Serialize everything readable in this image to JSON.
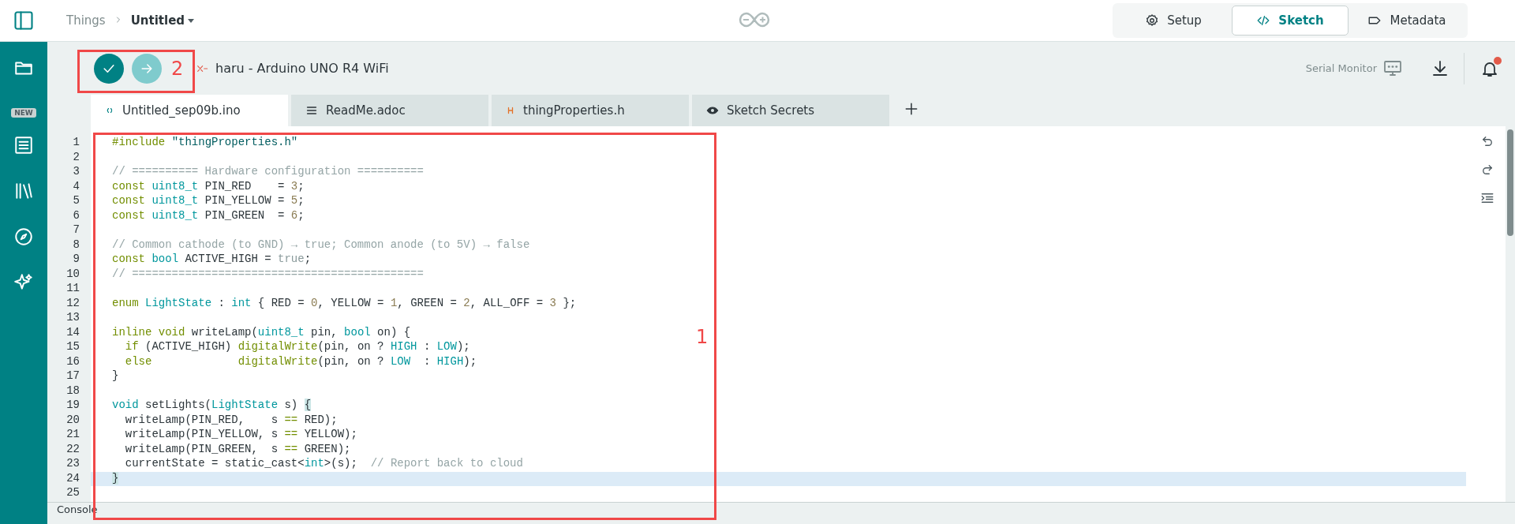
{
  "header": {
    "breadcrumb_root": "Things",
    "breadcrumb_current": "Untitled"
  },
  "view_tabs": [
    {
      "label": "Setup",
      "kind": "setup",
      "selected": false
    },
    {
      "label": "Sketch",
      "kind": "sketch",
      "selected": true
    },
    {
      "label": "Metadata",
      "kind": "metadata",
      "selected": false
    }
  ],
  "sidebar": {
    "new_badge": "NEW"
  },
  "toolbar": {
    "board": "haru - Arduino UNO R4 WiFi",
    "board_connected": false,
    "serial_monitor": "Serial Monitor",
    "notifications_unread": true
  },
  "file_tabs": [
    {
      "label": "Untitled_sep09b.ino",
      "kind": "code",
      "selected": true
    },
    {
      "label": "ReadMe.adoc",
      "kind": "doc",
      "selected": false
    },
    {
      "label": "thingProperties.h",
      "kind": "header",
      "selected": false
    },
    {
      "label": "Sketch Secrets",
      "kind": "secrets",
      "selected": false
    }
  ],
  "editor": {
    "lines": [
      {
        "number": "1",
        "current": false,
        "tokens": [
          {
            "text": "#include ",
            "kind": "kw"
          },
          {
            "text": "\"thingProperties.h\"",
            "kind": "str"
          }
        ]
      },
      {
        "number": "2",
        "current": false
      },
      {
        "number": "3",
        "current": false,
        "tokens": [
          {
            "text": "// ========== Hardware configuration ==========",
            "kind": "com"
          }
        ]
      },
      {
        "number": "4",
        "current": false,
        "tokens": [
          {
            "text": "const ",
            "kind": "kw"
          },
          {
            "text": "uint8_t",
            "kind": "type"
          },
          {
            "text": " PIN_RED    = ",
            "kind": "plain"
          },
          {
            "text": "3",
            "kind": "num"
          },
          {
            "text": ";",
            "kind": "plain"
          }
        ]
      },
      {
        "number": "5",
        "current": false,
        "tokens": [
          {
            "text": "const ",
            "kind": "kw"
          },
          {
            "text": "uint8_t",
            "kind": "type"
          },
          {
            "text": " PIN_YELLOW = ",
            "kind": "plain"
          },
          {
            "text": "5",
            "kind": "num"
          },
          {
            "text": ";",
            "kind": "plain"
          }
        ]
      },
      {
        "number": "6",
        "current": false,
        "tokens": [
          {
            "text": "const ",
            "kind": "kw"
          },
          {
            "text": "uint8_t",
            "kind": "type"
          },
          {
            "text": " PIN_GREEN  = ",
            "kind": "plain"
          },
          {
            "text": "6",
            "kind": "num"
          },
          {
            "text": ";",
            "kind": "plain"
          }
        ]
      },
      {
        "number": "7",
        "current": false
      },
      {
        "number": "8",
        "current": false,
        "tokens": [
          {
            "text": "// Common cathode (to GND) → true; Common anode (to 5V) → false",
            "kind": "com"
          }
        ]
      },
      {
        "number": "9",
        "current": false,
        "tokens": [
          {
            "text": "const ",
            "kind": "kw"
          },
          {
            "text": "bool",
            "kind": "type"
          },
          {
            "text": " ACTIVE_HIGH = ",
            "kind": "plain"
          },
          {
            "text": "true",
            "kind": "lit"
          },
          {
            "text": ";",
            "kind": "plain"
          }
        ]
      },
      {
        "number": "10",
        "current": false,
        "tokens": [
          {
            "text": "// ============================================",
            "kind": "com"
          }
        ]
      },
      {
        "number": "11",
        "current": false
      },
      {
        "number": "12",
        "current": false,
        "tokens": [
          {
            "text": "enum ",
            "kind": "kw"
          },
          {
            "text": "LightState",
            "kind": "type"
          },
          {
            "text": " : ",
            "kind": "plain"
          },
          {
            "text": "int",
            "kind": "type"
          },
          {
            "text": " { RED = ",
            "kind": "plain"
          },
          {
            "text": "0",
            "kind": "num"
          },
          {
            "text": ", YELLOW = ",
            "kind": "plain"
          },
          {
            "text": "1",
            "kind": "num"
          },
          {
            "text": ", GREEN = ",
            "kind": "plain"
          },
          {
            "text": "2",
            "kind": "num"
          },
          {
            "text": ", ALL_OFF = ",
            "kind": "plain"
          },
          {
            "text": "3",
            "kind": "num"
          },
          {
            "text": " };",
            "kind": "plain"
          }
        ]
      },
      {
        "number": "13",
        "current": false
      },
      {
        "number": "14",
        "current": false,
        "tokens": [
          {
            "text": "inline void",
            "kind": "kw"
          },
          {
            "text": " writeLamp(",
            "kind": "plain"
          },
          {
            "text": "uint8_t",
            "kind": "type"
          },
          {
            "text": " pin, ",
            "kind": "plain"
          },
          {
            "text": "bool",
            "kind": "type"
          },
          {
            "text": " on) {",
            "kind": "plain"
          }
        ]
      },
      {
        "number": "15",
        "current": false,
        "tokens": [
          {
            "text": "  if",
            "kind": "kw"
          },
          {
            "text": " (ACTIVE_HIGH) ",
            "kind": "plain"
          },
          {
            "text": "digitalWrite",
            "kind": "kw"
          },
          {
            "text": "(pin, on ? ",
            "kind": "plain"
          },
          {
            "text": "HIGH",
            "kind": "type"
          },
          {
            "text": " : ",
            "kind": "plain"
          },
          {
            "text": "LOW",
            "kind": "type"
          },
          {
            "text": ");",
            "kind": "plain"
          }
        ]
      },
      {
        "number": "16",
        "current": false,
        "tokens": [
          {
            "text": "  else             ",
            "kind": "kw"
          },
          {
            "text": "digitalWrite",
            "kind": "kw"
          },
          {
            "text": "(pin, on ? ",
            "kind": "plain"
          },
          {
            "text": "LOW",
            "kind": "type"
          },
          {
            "text": "  : ",
            "kind": "plain"
          },
          {
            "text": "HIGH",
            "kind": "type"
          },
          {
            "text": ");",
            "kind": "plain"
          }
        ]
      },
      {
        "number": "17",
        "current": false,
        "tokens": [
          {
            "text": "}",
            "kind": "plain"
          }
        ]
      },
      {
        "number": "18",
        "current": false
      },
      {
        "number": "19",
        "current": false,
        "tokens": [
          {
            "text": "void",
            "kind": "type"
          },
          {
            "text": " setLights(",
            "kind": "plain"
          },
          {
            "text": "LightState",
            "kind": "type"
          },
          {
            "text": " s) ",
            "kind": "plain"
          },
          {
            "text": "{",
            "kind": "match"
          }
        ]
      },
      {
        "number": "20",
        "current": false,
        "tokens": [
          {
            "text": "  writeLamp(PIN_RED,    s ",
            "kind": "plain"
          },
          {
            "text": "==",
            "kind": "kw"
          },
          {
            "text": " RED);",
            "kind": "plain"
          }
        ]
      },
      {
        "number": "21",
        "current": false,
        "tokens": [
          {
            "text": "  writeLamp(PIN_YELLOW, s ",
            "kind": "plain"
          },
          {
            "text": "==",
            "kind": "kw"
          },
          {
            "text": " YELLOW);",
            "kind": "plain"
          }
        ]
      },
      {
        "number": "22",
        "current": false,
        "tokens": [
          {
            "text": "  writeLamp(PIN_GREEN,  s ",
            "kind": "plain"
          },
          {
            "text": "==",
            "kind": "kw"
          },
          {
            "text": " GREEN);",
            "kind": "plain"
          }
        ]
      },
      {
        "number": "23",
        "current": false,
        "tokens": [
          {
            "text": "  currentState = static_cast<",
            "kind": "plain"
          },
          {
            "text": "int",
            "kind": "type"
          },
          {
            "text": ">(s);  ",
            "kind": "plain"
          },
          {
            "text": "// Report back to cloud",
            "kind": "com"
          }
        ]
      },
      {
        "number": "24",
        "current": true,
        "tokens": [
          {
            "text": "}",
            "kind": "match"
          }
        ]
      },
      {
        "number": "25",
        "current": false
      }
    ]
  },
  "console": {
    "label": "Console"
  },
  "annotations": [
    {
      "label": "1",
      "kind": "code"
    },
    {
      "label": "2",
      "kind": "toolbar"
    }
  ]
}
